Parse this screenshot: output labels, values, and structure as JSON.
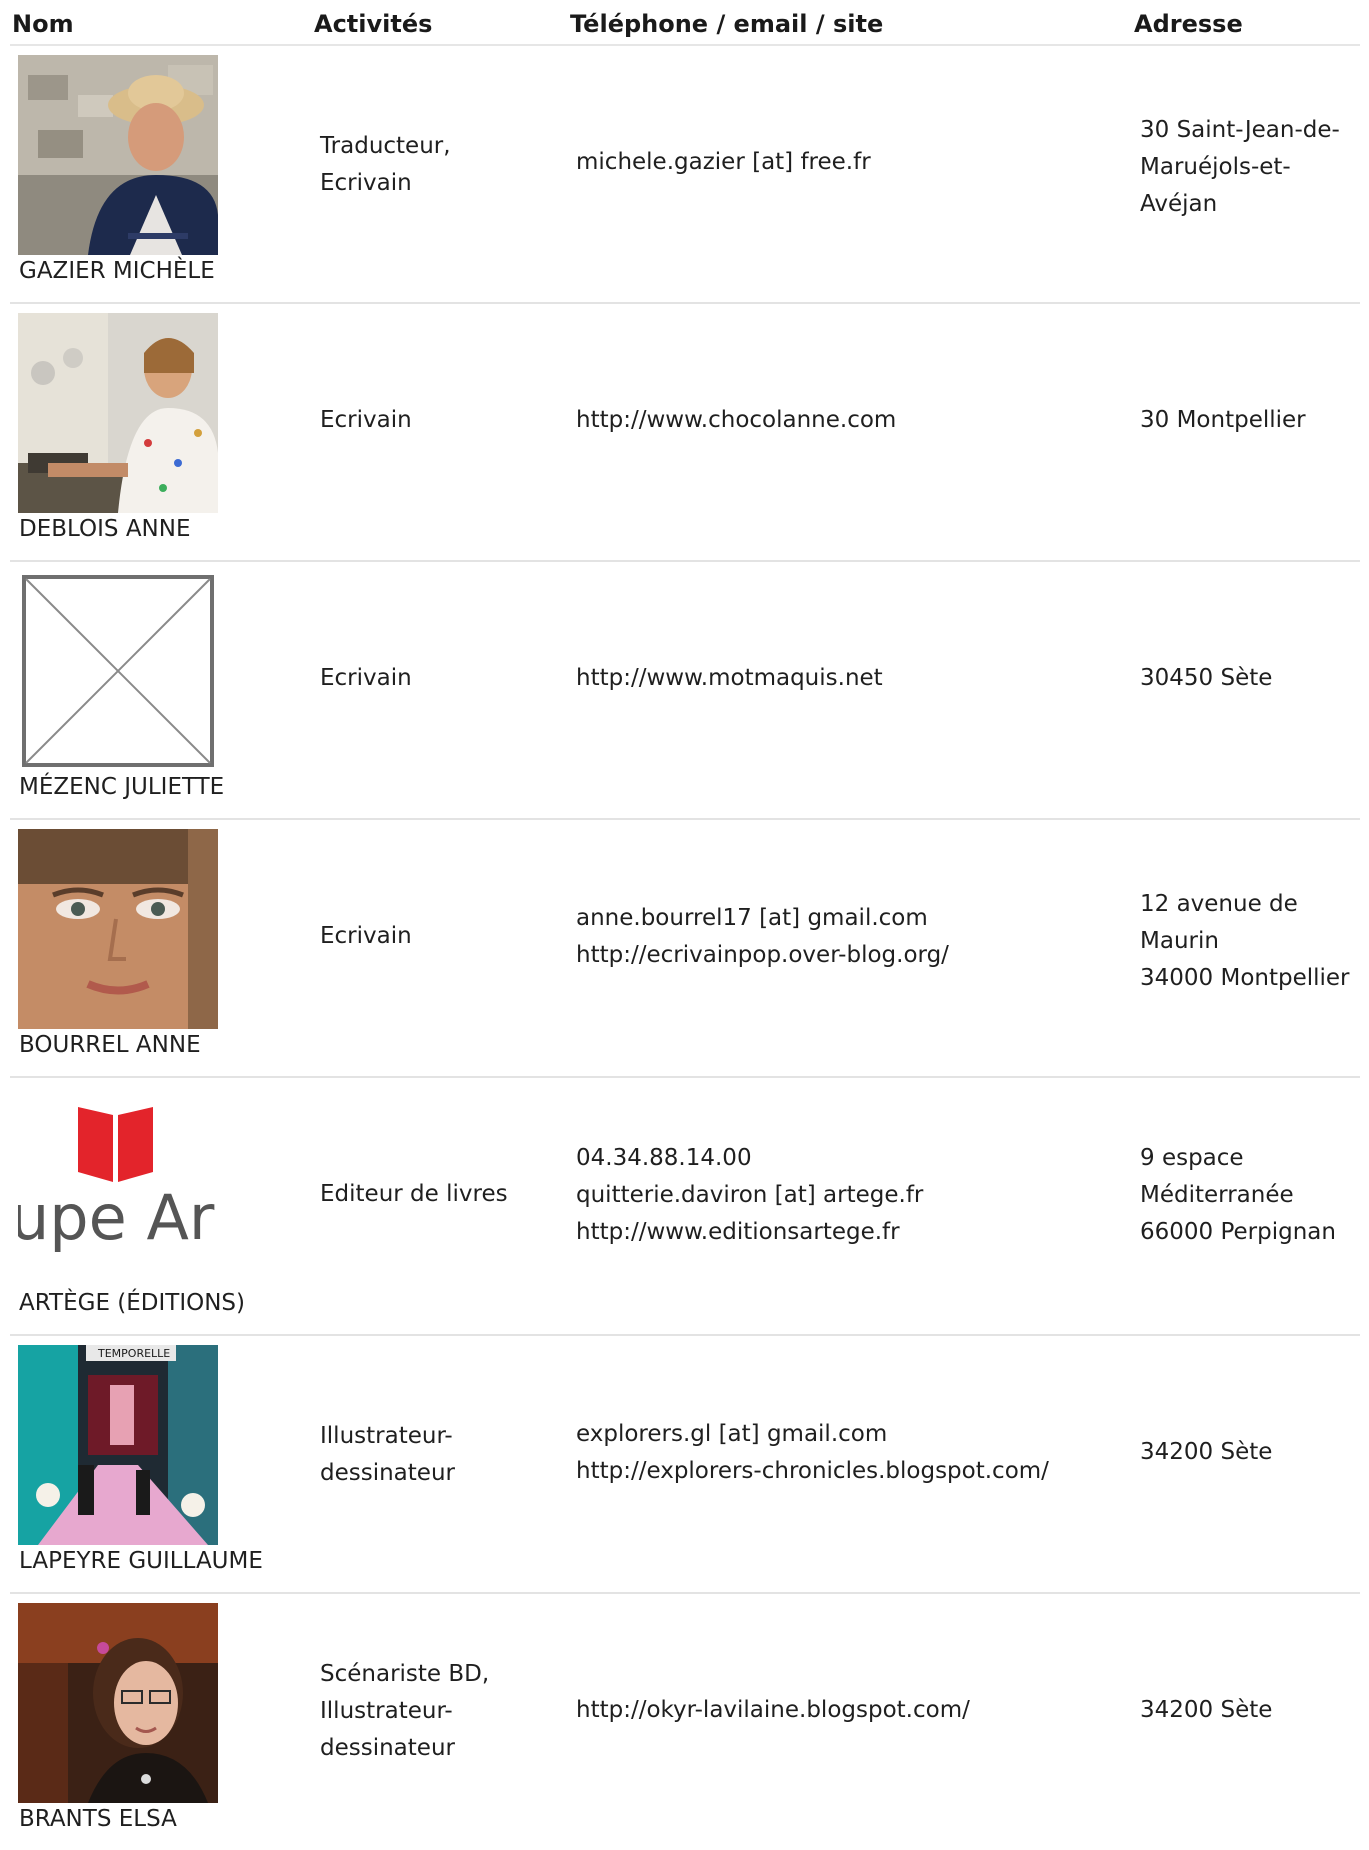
{
  "header": {
    "col_name": "Nom",
    "col_activities": "Activités",
    "col_contact": "Téléphone / email / site",
    "col_address": "Adresse"
  },
  "rows": [
    {
      "name": "GAZIER MICHÈLE",
      "activities": [
        "Traducteur,",
        "Ecrivain"
      ],
      "contact": [
        "michele.gazier [at] free.fr"
      ],
      "address": [
        "30 Saint-Jean-de-",
        "Maruéjols-et-",
        "Avéjan"
      ]
    },
    {
      "name": "DEBLOIS ANNE",
      "activities": [
        "Ecrivain"
      ],
      "contact": [
        "http://www.chocolanne.com"
      ],
      "address": [
        "30 Montpellier"
      ]
    },
    {
      "name": "MÉZENC JULIETTE",
      "activities": [
        "Ecrivain"
      ],
      "contact": [
        "http://www.motmaquis.net"
      ],
      "address": [
        "30450 Sète"
      ]
    },
    {
      "name": "BOURREL ANNE",
      "activities": [
        "Ecrivain"
      ],
      "contact": [
        "anne.bourrel17 [at] gmail.com",
        "http://ecrivainpop.over-blog.org/"
      ],
      "address": [
        "12 avenue de",
        "Maurin",
        "34000 Montpellier"
      ]
    },
    {
      "name": "ARTÈGE (ÉDITIONS)",
      "activities": [
        "Editeur de livres"
      ],
      "contact": [
        "04.34.88.14.00",
        "quitterie.daviron [at] artege.fr",
        "http://www.editionsartege.fr"
      ],
      "address": [
        "9 espace",
        "Méditerranée",
        "66000 Perpignan"
      ],
      "logo_text": "upe Ar"
    },
    {
      "name": "LAPEYRE GUILLAUME",
      "activities": [
        "Illustrateur-",
        "dessinateur"
      ],
      "contact": [
        "explorers.gl [at] gmail.com",
        "http://explorers-chronicles.blogspot.com/"
      ],
      "address": [
        "34200 Sète"
      ],
      "cover_text": "TEMPORELLE"
    },
    {
      "name": "BRANTS ELSA",
      "activities": [
        "Scénariste BD,",
        "Illustrateur-",
        "dessinateur"
      ],
      "contact": [
        "http://okyr-lavilaine.blogspot.com/"
      ],
      "address": [
        "34200 Sète"
      ]
    }
  ]
}
